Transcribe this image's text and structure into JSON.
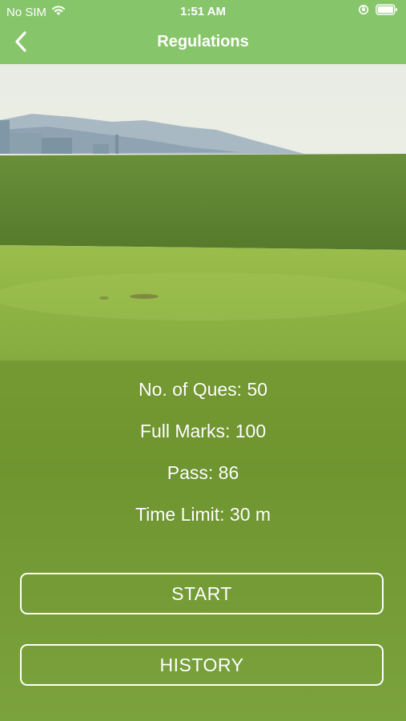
{
  "status_bar": {
    "carrier": "No SIM",
    "time": "1:51 AM"
  },
  "nav": {
    "title": "Regulations",
    "back_icon": "chevron-left-icon"
  },
  "info": {
    "questions": "No. of Ques: 50",
    "full_marks": "Full Marks: 100",
    "pass": "Pass: 86",
    "time_limit": "Time Limit: 30 m"
  },
  "buttons": {
    "start": "START",
    "history": "HISTORY"
  },
  "colors": {
    "header": "#86c56a",
    "background": "#7a9c34",
    "text": "#ffffff"
  }
}
